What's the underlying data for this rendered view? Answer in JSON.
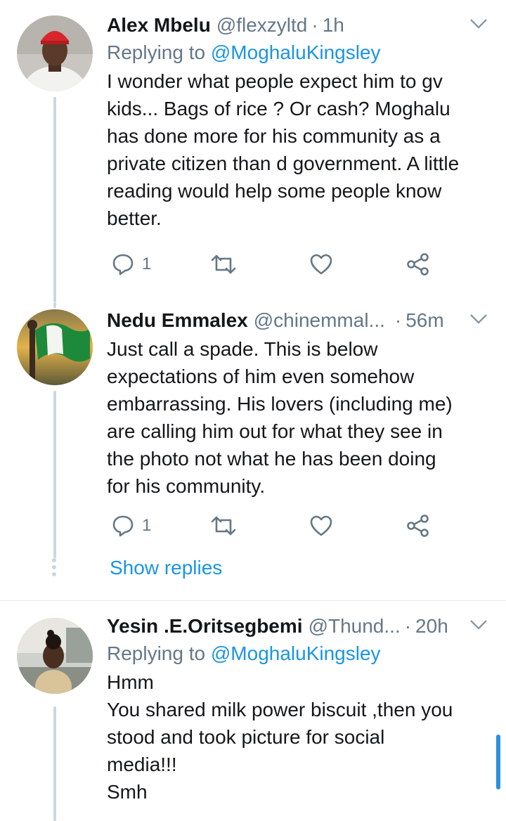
{
  "tweets": [
    {
      "name": "Alex Mbelu",
      "handle": "@flexzyltd",
      "time": "1h",
      "replying_prefix": "Replying to",
      "replying_to": "@MoghaluKingsley",
      "lines": [
        "I wonder what people expect him to gv",
        "kids... Bags of rice ? Or cash? Moghalu",
        "has done more for his community as a",
        "private citizen than d government. A little",
        "reading would help some people know",
        "better."
      ],
      "reply_count": "1",
      "avatar": "avatar-man-red-cap"
    },
    {
      "name": "Nedu Emmalex",
      "handle": "@chinemmal...",
      "time": "56m",
      "lines": [
        "Just call a spade. This is below",
        "expectations of him even somehow",
        "embarrassing. His lovers (including me)",
        "are calling him out for what they see in",
        "the photo not what he has been doing",
        "for his community."
      ],
      "reply_count": "1",
      "avatar": "avatar-flag-green-white",
      "show_replies": "Show replies"
    },
    {
      "name": "Yesin .E.Oritsegbemi",
      "handle": "@Thund...",
      "time": "20h",
      "replying_prefix": "Replying to",
      "replying_to": "@MoghaluKingsley",
      "lines": [
        "Hmm",
        "You shared milk power biscuit ,then you",
        "stood and took picture for social",
        "media!!!",
        "Smh"
      ],
      "avatar": "avatar-child-photo"
    }
  ],
  "icons": {
    "reply": "reply-icon",
    "retweet": "retweet-icon",
    "like": "heart-icon",
    "share": "share-icon",
    "more": "chevron-down-icon"
  },
  "colors": {
    "text": "#14171a",
    "secondary": "#657786",
    "link": "#1b95e0",
    "thread_line": "#ccd6dd"
  }
}
